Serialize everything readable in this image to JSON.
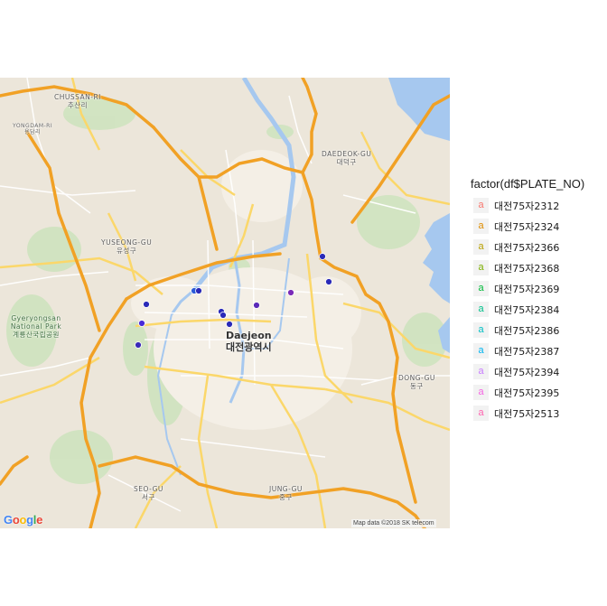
{
  "map": {
    "places": {
      "chussan": {
        "en": "CHUSSAN-RI",
        "ko": "추산리"
      },
      "yongdam": {
        "en": "YONGDAM-RI",
        "ko": "용담리"
      },
      "daedeok": {
        "en": "DAEDEOK-GU",
        "ko": "대덕구"
      },
      "yuseong": {
        "en": "YUSEONG-GU",
        "ko": "유성구"
      },
      "gyeryongsan": {
        "en": "Gyeryongsan National Park",
        "ko": "계룡산국립공원"
      },
      "daejeon": {
        "en": "Daejeon",
        "ko": "대전광역시"
      },
      "dong": {
        "en": "DONG-GU",
        "ko": "동구"
      },
      "seo": {
        "en": "SEO-GU",
        "ko": "서구"
      },
      "jung": {
        "en": "JUNG-GU",
        "ko": "중구"
      }
    },
    "google_logo": "Google",
    "attribution": "Map data ©2018 SK telecom"
  },
  "legend": {
    "title": "factor(df$PLATE_NO)",
    "key_glyph": "a",
    "items": [
      {
        "label": "대전75자2312",
        "color": "#F8766D"
      },
      {
        "label": "대전75자2324",
        "color": "#DE8C00"
      },
      {
        "label": "대전75자2366",
        "color": "#B79F00"
      },
      {
        "label": "대전75자2368",
        "color": "#7CAE00"
      },
      {
        "label": "대전75자2369",
        "color": "#00BA38"
      },
      {
        "label": "대전75자2384",
        "color": "#00C08B"
      },
      {
        "label": "대전75자2386",
        "color": "#00BFC4"
      },
      {
        "label": "대전75자2387",
        "color": "#00B4F0"
      },
      {
        "label": "대전75자2394",
        "color": "#C77CFF"
      },
      {
        "label": "대전75자2395",
        "color": "#F564E3"
      },
      {
        "label": "대전75자2513",
        "color": "#FF64B0"
      }
    ]
  },
  "markers_color": "#2a2ab8"
}
